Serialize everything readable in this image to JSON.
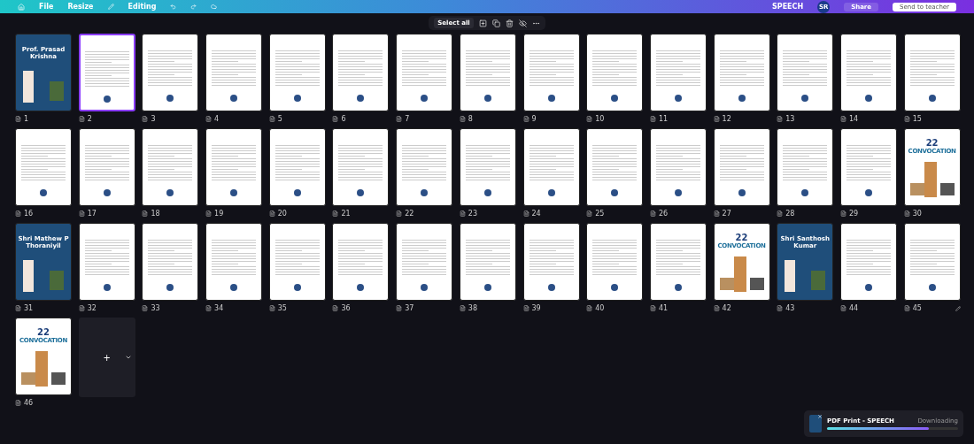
{
  "header": {
    "menu": [
      "File",
      "Resize"
    ],
    "mode": "Editing",
    "doc_title": "SPEECH",
    "avatar": "SR",
    "share": "Share",
    "send": "Send to teacher"
  },
  "toolbar": {
    "select_all": "Select all"
  },
  "pages": [
    {
      "number": "1",
      "kind": "cover",
      "title": "Prof. Prasad Krishna",
      "selected": false
    },
    {
      "number": "2",
      "kind": "letter",
      "selected": true
    },
    {
      "number": "3",
      "kind": "letter",
      "selected": false
    },
    {
      "number": "4",
      "kind": "letter",
      "selected": false
    },
    {
      "number": "5",
      "kind": "letter",
      "selected": false
    },
    {
      "number": "6",
      "kind": "letter",
      "selected": false
    },
    {
      "number": "7",
      "kind": "letter",
      "selected": false
    },
    {
      "number": "8",
      "kind": "letter",
      "selected": false
    },
    {
      "number": "9",
      "kind": "letter",
      "selected": false
    },
    {
      "number": "10",
      "kind": "letter",
      "selected": false
    },
    {
      "number": "11",
      "kind": "letter",
      "selected": false
    },
    {
      "number": "12",
      "kind": "letter",
      "selected": false
    },
    {
      "number": "13",
      "kind": "letter",
      "selected": false
    },
    {
      "number": "14",
      "kind": "letter",
      "selected": false
    },
    {
      "number": "15",
      "kind": "letter",
      "selected": false
    },
    {
      "number": "16",
      "kind": "letter",
      "selected": false
    },
    {
      "number": "17",
      "kind": "letter",
      "selected": false
    },
    {
      "number": "18",
      "kind": "letter",
      "selected": false
    },
    {
      "number": "19",
      "kind": "letter",
      "selected": false
    },
    {
      "number": "20",
      "kind": "letter",
      "selected": false
    },
    {
      "number": "21",
      "kind": "letter",
      "selected": false
    },
    {
      "number": "22",
      "kind": "letter",
      "selected": false
    },
    {
      "number": "23",
      "kind": "letter",
      "selected": false
    },
    {
      "number": "24",
      "kind": "letter",
      "selected": false
    },
    {
      "number": "25",
      "kind": "letter",
      "selected": false
    },
    {
      "number": "26",
      "kind": "letter",
      "selected": false
    },
    {
      "number": "27",
      "kind": "letter",
      "selected": false
    },
    {
      "number": "28",
      "kind": "letter",
      "selected": false
    },
    {
      "number": "29",
      "kind": "letter",
      "selected": false
    },
    {
      "number": "30",
      "kind": "convocation",
      "badge": "22",
      "title": "CONVOCATION",
      "selected": false
    },
    {
      "number": "31",
      "kind": "cover",
      "title": "Shri Mathew P Thoraniyil",
      "selected": false
    },
    {
      "number": "32",
      "kind": "letter",
      "selected": false
    },
    {
      "number": "33",
      "kind": "letter",
      "selected": false
    },
    {
      "number": "34",
      "kind": "letter",
      "selected": false
    },
    {
      "number": "35",
      "kind": "letter",
      "selected": false
    },
    {
      "number": "36",
      "kind": "letter",
      "selected": false
    },
    {
      "number": "37",
      "kind": "letter",
      "selected": false
    },
    {
      "number": "38",
      "kind": "letter",
      "selected": false
    },
    {
      "number": "39",
      "kind": "letter",
      "selected": false
    },
    {
      "number": "40",
      "kind": "letter",
      "selected": false
    },
    {
      "number": "41",
      "kind": "letter",
      "selected": false
    },
    {
      "number": "42",
      "kind": "convocation",
      "badge": "22",
      "title": "CONVOCATION",
      "selected": false
    },
    {
      "number": "43",
      "kind": "cover",
      "title": "Shri Santhosh Kumar",
      "selected": false
    },
    {
      "number": "44",
      "kind": "letter",
      "selected": false
    },
    {
      "number": "45",
      "kind": "letter",
      "selected": false,
      "editable": true
    },
    {
      "number": "46",
      "kind": "convocation",
      "badge": "22",
      "title": "CONVOCATION",
      "selected": false
    }
  ],
  "add_page": {
    "plus": "+"
  },
  "download": {
    "title": "PDF Print - SPEECH",
    "status": "Downloading",
    "level": 0.78
  }
}
